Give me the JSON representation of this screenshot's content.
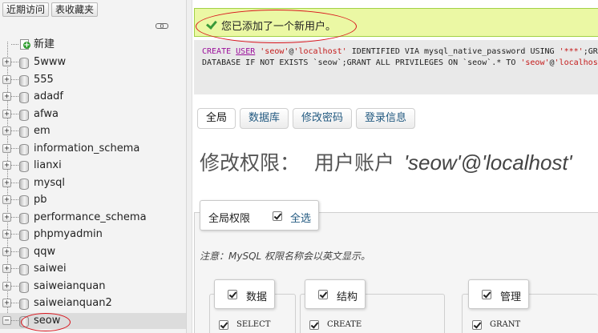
{
  "nav": {
    "tabs": [
      {
        "label": "近期访问"
      },
      {
        "label": "表收藏夹"
      }
    ],
    "collapse_icon": "link-chain-icon",
    "new_item": {
      "label": "新建",
      "icon": "new-database-icon"
    },
    "databases": [
      {
        "name": "5www",
        "expander": "+"
      },
      {
        "name": "555",
        "expander": "+"
      },
      {
        "name": "adadf",
        "expander": "+"
      },
      {
        "name": "afwa",
        "expander": "+"
      },
      {
        "name": "em",
        "expander": "+"
      },
      {
        "name": "information_schema",
        "expander": "+"
      },
      {
        "name": "lianxi",
        "expander": "+"
      },
      {
        "name": "mysql",
        "expander": "+"
      },
      {
        "name": "pb",
        "expander": "+"
      },
      {
        "name": "performance_schema",
        "expander": "+"
      },
      {
        "name": "phpmyadmin",
        "expander": "+"
      },
      {
        "name": "qqw",
        "expander": "+"
      },
      {
        "name": "saiwei",
        "expander": "+"
      },
      {
        "name": "saiweianquan",
        "expander": "+"
      },
      {
        "name": "saiweianquan2",
        "expander": "+"
      },
      {
        "name": "seow",
        "expander": "−",
        "selected": true
      }
    ]
  },
  "message": {
    "text": "您已添加了一个新用户。",
    "icon": "success-check-icon",
    "color": "#ebf8a4"
  },
  "sql": {
    "line1": {
      "kw1": "CREATE",
      "kw2": "USER",
      "str1": "'seow'",
      "mid1": "@",
      "str2": "'localhost'",
      "mid2": " IDENTIFIED VIA mysql_native_password USING ",
      "str3": "'***'",
      "tail": ";GRA"
    },
    "line2": {
      "head": "DATABASE IF NOT EXISTS ",
      "ident1": "`seow`",
      "mid": ";GRANT ALL PRIVILEGES ON ",
      "ident2": "`seow`",
      "mid2": ".* TO ",
      "str1": "'seow'",
      "mid3": "@",
      "str2": "'localhost'"
    }
  },
  "tabs": [
    {
      "label": "全局",
      "active": true
    },
    {
      "label": "数据库"
    },
    {
      "label": "修改密码"
    },
    {
      "label": "登录信息"
    }
  ],
  "title": {
    "prefix": "修改权限：",
    "account": "用户账户",
    "userhost": "'seow'@'localhost'"
  },
  "global": {
    "legend": "全局权限",
    "select_all": "全选"
  },
  "note": "注意：MySQL 权限名称会以英文显示。",
  "groups": [
    {
      "label": "数据",
      "first_priv": "SELECT"
    },
    {
      "label": "结构",
      "first_priv": "CREATE"
    },
    {
      "label": "管理",
      "first_priv": "GRANT"
    }
  ],
  "colors": {
    "annotation": "#d9141c",
    "link": "#235a81"
  }
}
